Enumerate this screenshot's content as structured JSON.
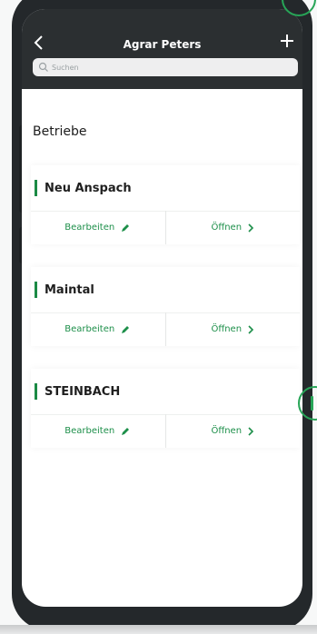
{
  "app": {
    "title": "Agrar Peters",
    "back_glyph": "‹",
    "add_glyph": "+"
  },
  "search": {
    "placeholder": "Suchen"
  },
  "section": {
    "heading": "Betriebe"
  },
  "farms": [
    {
      "name": "Neu Anspach",
      "edit_label": "Bearbeiten",
      "open_label": "Öffnen"
    },
    {
      "name": "Maintal",
      "edit_label": "Bearbeiten",
      "open_label": "Öffnen"
    },
    {
      "name": "STEINBACH",
      "edit_label": "Bearbeiten",
      "open_label": "Öffnen"
    }
  ],
  "colors": {
    "accent": "#1b8a45",
    "header": "#2b2f31",
    "ring": "#27a557"
  },
  "icons": {
    "back": "chevron-left-icon",
    "add": "plus-icon",
    "search": "search-icon",
    "edit": "pencil-icon",
    "open": "chevron-right-icon"
  }
}
